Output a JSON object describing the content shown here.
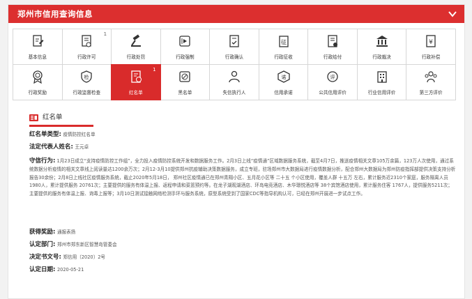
{
  "header": {
    "title": "郑州市信用查询信息"
  },
  "row1": [
    {
      "label": "基本信息",
      "count": "",
      "icon": "edit-doc-icon"
    },
    {
      "label": "行政许可",
      "count": "1",
      "icon": "license-icon"
    },
    {
      "label": "行政处罚",
      "count": "",
      "icon": "gavel-icon"
    },
    {
      "label": "行政强制",
      "count": "",
      "icon": "play-doc-icon"
    },
    {
      "label": "行政确认",
      "count": "",
      "icon": "confirm-doc-icon"
    },
    {
      "label": "行政征收",
      "count": "",
      "icon": "levy-icon"
    },
    {
      "label": "行政给付",
      "count": "",
      "icon": "payment-doc-icon"
    },
    {
      "label": "行政裁决",
      "count": "",
      "icon": "courthouse-icon"
    },
    {
      "label": "行政补偿",
      "count": "",
      "icon": "yen-doc-icon"
    }
  ],
  "row2": [
    {
      "label": "行政奖励",
      "count": "",
      "icon": "medal-icon"
    },
    {
      "label": "行政监督检查",
      "count": "",
      "icon": "inspection-icon"
    },
    {
      "label": "红名单",
      "count": "1",
      "icon": "red-list-icon"
    },
    {
      "label": "黑名单",
      "count": "",
      "icon": "blacklist-icon"
    },
    {
      "label": "失信执行人",
      "count": "",
      "icon": "person-icon"
    },
    {
      "label": "信用承诺",
      "count": "",
      "icon": "promise-icon"
    },
    {
      "label": "公共信用评价",
      "count": "",
      "icon": "rating-icon"
    },
    {
      "label": "行业信用评价",
      "count": "",
      "icon": "building-icon"
    },
    {
      "label": "第三方评价",
      "count": "",
      "icon": "group-icon"
    }
  ],
  "section": {
    "heading": "红名单",
    "type_key": "红名单类型:",
    "type_val": "疫情防控红名单",
    "rep_key": "法定代表人姓名:",
    "rep_val": "王元卓",
    "action_key": "守信行为:",
    "action_val": "1月23日成立“支持疫情防控工作组”，全力投入疫情防控系统开发和数据服务工作。2月3日上线“疫情通”区域数据服务系统，截至4月7日，推送疫情相关文章105万余篇，123万人次使用，通过系统数据分析疫情的相关文章线上阅读量达1200余万次；2月12-3月10提供郑州抗疫辅助决策数据服务，成立专班，驻场郑州市大数据局进行疫情数据分析，配合郑州大数据局为郑州防疫指挥部提供决策支持分析报告30余份；2月8日上线社区疫情服务系统，截止2020年5月18日， 郑州社区疫情通已在郑州青翔小区、五月花小区等 二十五 个小区使用，覆盖人群 十五万 左右，累计服务近2310个家庭，服务隔离人员 1980人，累计提供服务 20761次；主要提供的服务有体温上报、返程申请和菜篮预约等。在龙子湖观湖酒店、环岛电竞酒店、木华璟悦酒店等 38个宾馆酒店使用，累计服务住客 1767人，提供服务5211次；主要提供的服务有体温上报、询毒上报等；3月10日测试接触网络检测手环与服务系统，原型系统受到了国家CDC等指导机构认可，已经在郑州开展进一步试点工作。",
    "reward_key": "获得奖励:",
    "reward_val": "通报表扬",
    "dept_key": "认定部门:",
    "dept_val": "郑州市郑东新区智慧岛管委会",
    "doc_key": "决定书文号:",
    "doc_val": "郑信用〔2020〕2号",
    "date_key": "认定日期:",
    "date_val": "2020-05-21"
  },
  "colors": {
    "accent": "#d92b2b"
  }
}
